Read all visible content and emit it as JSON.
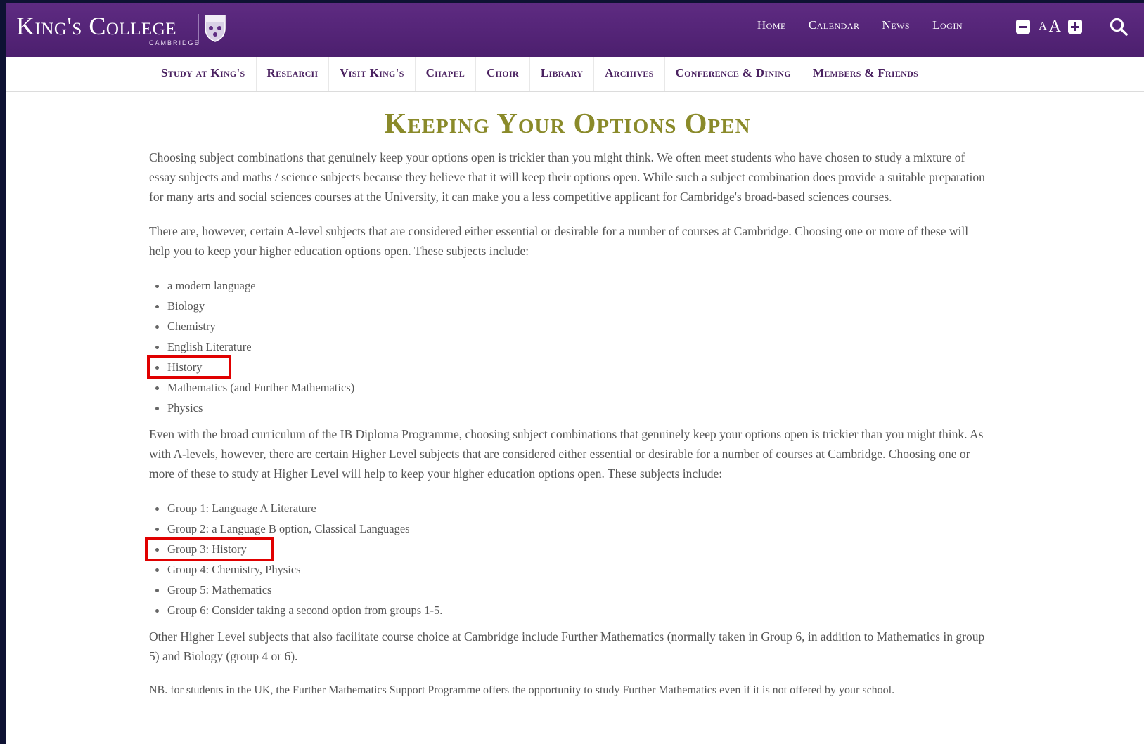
{
  "header": {
    "logo_title": "King's College",
    "logo_sub": "CAMBRIDGE",
    "top_links": [
      "Home",
      "Calendar",
      "News",
      "Login"
    ],
    "text_size_small": "A",
    "text_size_large": "A"
  },
  "mainnav": {
    "items": [
      "Study at King's",
      "Research",
      "Visit King's",
      "Chapel",
      "Choir",
      "Library",
      "Archives",
      "Conference & Dining",
      "Members & Friends"
    ]
  },
  "article": {
    "title": "Keeping Your Options Open",
    "para1": "Choosing subject combinations that genuinely keep your options open is trickier than you might think. We often meet students who have chosen to study a mixture of essay subjects and maths / science subjects because they believe that it will keep their options open. While such a subject combination does provide a suitable preparation for many arts and social sciences courses at the University, it can make you a less competitive applicant for Cambridge's broad-based sciences courses.",
    "para2": "There are, however, certain A-level subjects that are considered either essential or desirable for a number of courses at Cambridge. Choosing one or more of these will help you to keep your higher education options open. These subjects include:",
    "alevel_subjects": [
      "a modern language",
      "Biology",
      "Chemistry",
      "English Literature",
      "History",
      "Mathematics (and Further Mathematics)",
      "Physics"
    ],
    "para3": "Even with the broad curriculum of the IB Diploma Programme, choosing subject combinations that genuinely keep your options open is trickier than you might think. As with A-levels, however, there are certain Higher Level subjects that are considered either essential or desirable for a number of courses at Cambridge. Choosing one or more of these to study at Higher Level will help to keep your higher education options open. These subjects include:",
    "ib_groups": [
      "Group 1: Language A Literature",
      "Group 2: a Language B option, Classical Languages",
      "Group 3: History",
      "Group 4: Chemistry, Physics",
      "Group 5: Mathematics",
      "Group 6: Consider taking a second option from groups 1-5."
    ],
    "para4": "Other Higher Level subjects that also facilitate course choice at Cambridge include Further Mathematics (normally taken in Group 6, in addition to Mathematics in group 5) and Biology (group 4 or 6).",
    "nb": "NB. for students in the UK, the Further Mathematics Support Programme offers the opportunity to study Further Mathematics even if it is not offered by your school."
  },
  "colors": {
    "header_purple": "#4c1f6e",
    "nav_text": "#4a2160",
    "title_olive": "#8a8a2a",
    "highlight_red": "#e00000"
  },
  "icons": [
    "crest-icon",
    "text-decrease-icon",
    "text-increase-icon",
    "search-icon"
  ]
}
